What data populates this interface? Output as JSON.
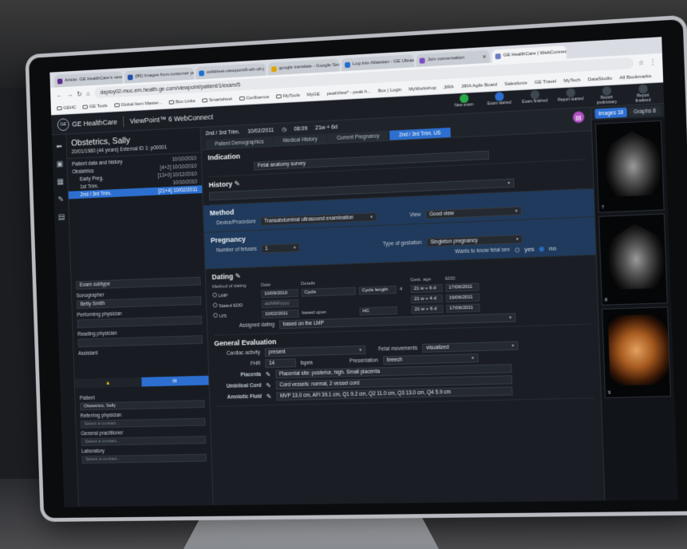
{
  "browser": {
    "tabs": [
      {
        "label": "Article: GE HealthCare's new H",
        "color": "#5b2d90"
      },
      {
        "label": "(86) Images from customer pro",
        "color": "#1f4fa8"
      },
      {
        "label": "cellsheet-viewpoint6-wh-uh-j",
        "color": "#1f6fd0"
      },
      {
        "label": "google translate - Google Sear",
        "color": "#e2a400"
      },
      {
        "label": "Log into Atlassian - GE Ultrasou",
        "color": "#1f6fd0"
      },
      {
        "label": "Join conversation",
        "color": "#7a4fc4"
      },
      {
        "label": "GE HealthCare | WebConnect",
        "color": "#6b7cc4"
      }
    ],
    "url": "deploy02-muc.em.health.ge.com/viewpoint/patient/1/exam/5",
    "bookmarks": [
      "GEHC",
      "GE Tools",
      "Global Item Master...",
      "Box Links",
      "Smartsheet",
      "Confluence",
      "MyTools",
      "MyGE",
      "peakView* - peak h...",
      "Box | Login",
      "MyWorkshop",
      "JIRA",
      "JIRA Agile Board",
      "Salesforce",
      "GE Travel",
      "MyTech",
      "DataStudio"
    ],
    "all_bookmarks": "All Bookmarks"
  },
  "app": {
    "brand": "GE HealthCare",
    "product": "ViewPoint™ 6 WebConnect",
    "workflow": [
      "New exam",
      "Exam started",
      "Exam finished",
      "Report started",
      "Report preliminary",
      "Report finalized"
    ]
  },
  "patient": {
    "name": "Obstetrics, Sally",
    "dob": "20/01/1980 (44 years)  External ID 1: p00001",
    "tree": [
      {
        "label": "Patient data and history",
        "count": "",
        "date": "10/10/2010"
      },
      {
        "label": "Obstetrics",
        "count": "[4+2]",
        "date": "10/10/2010"
      },
      {
        "label": "Early Preg.",
        "count": "[13+0]",
        "date": "10/12/2010"
      },
      {
        "label": "1st Trim.",
        "count": "",
        "date": "10/10/2010"
      },
      {
        "label": "2nd / 3rd Trim.",
        "count": "[21+4]",
        "date": "10/02/2011"
      }
    ]
  },
  "leftfields": {
    "exam_subtype": "Exam subtype",
    "sonographer": "Sonographer",
    "sonographer_value": "Betty Smith",
    "performing": "Performing physician",
    "reading": "Reading physician",
    "assistant": "Assistant"
  },
  "contacts": {
    "patient": "Patient",
    "patient_value": "Obstetrics, Sally",
    "referring": "Referring physician",
    "gp": "General practitioner",
    "lab": "Laboratory",
    "placeholder": "Select a contact..."
  },
  "exam": {
    "title": "2nd / 3rd Trim.",
    "date": "10/02/2011",
    "time": "08:09",
    "ga": "21w + 6d",
    "tabs": [
      "Patient Demographics",
      "Medical History",
      "Current Pregnancy",
      "2nd / 3rd Trim. US"
    ]
  },
  "form": {
    "indication": "Indication",
    "indication_value": "Fetal anatomy survey",
    "history": "History",
    "method": "Method",
    "device_label": "Device/Procedure",
    "device_value": "Transabdominal ultrasound examination",
    "view_label": "View",
    "view_value": "Good view",
    "pregnancy": "Pregnancy",
    "fetuses_label": "Number of fetuses",
    "fetuses_value": "1",
    "gestation_label": "Type of gestation",
    "gestation_value": "Singleton pregnancy",
    "sex_label": "Wants to know fetal sex",
    "yes": "yes",
    "no": "no",
    "dating": "Dating",
    "dating_headers": [
      "Method of dating",
      "Date",
      "Details",
      "",
      "",
      "Gest. age",
      "EDD"
    ],
    "lmp": "LMP",
    "lmp_date": "10/09/2010",
    "cycle": "Cycle",
    "cycle_length": "Cycle length",
    "cycle_val": "4",
    "lmp_ga": "21 w + 6 d",
    "lmp_edd": "17/06/2011",
    "stated": "Stated EDD",
    "placeholder_date": "dd/MM/yyyy",
    "stated_ga": "21 w + 4 d",
    "stated_edd": "19/06/2011",
    "us": "U/S",
    "us_date": "10/02/2011",
    "based": "based upon",
    "hc": "HC",
    "us_ga": "21 w + 6 d",
    "us_edd": "17/06/2011",
    "assigned_label": "Assigned dating",
    "assigned_value": "based on the LMP",
    "general": "General Evaluation",
    "cardiac_label": "Cardiac activity",
    "cardiac_value": "present",
    "fhr_label": "FHR",
    "fhr_value": "14",
    "bpm": "bpm",
    "fm_label": "Fetal movements",
    "fm_value": "visualized",
    "pres_label": "Presentation",
    "pres_value": "breech",
    "placenta_label": "Placenta",
    "placenta_value": "Placental site: posterior, high. Small placenta",
    "cord_label": "Umbilical Cord",
    "cord_value": "Cord vessels: normal, 2 vessel cord",
    "fluid_label": "Amniotic Fluid",
    "fluid_value": "MVP 13.0 cm, AFI 39.1 cm, Q1 9.2 cm, Q2 11.0 cm, Q3 13.0 cm, Q4 5.9 cm"
  },
  "right": {
    "images_tab": "Images",
    "images_count": "18",
    "graphs_tab": "Graphs",
    "graphs_count": "8",
    "thumbs": [
      "7",
      "8",
      "9"
    ]
  }
}
